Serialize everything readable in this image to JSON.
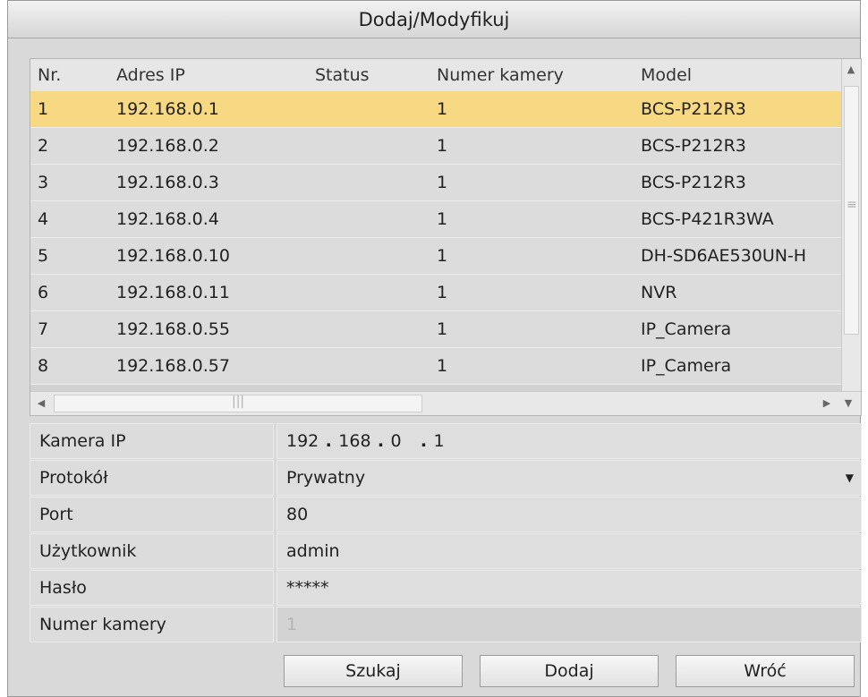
{
  "window": {
    "title": "Dodaj/Modyfikuj"
  },
  "table": {
    "columns": [
      "Nr.",
      "Adres IP",
      "Status",
      "Numer kamery",
      "Model"
    ],
    "rows": [
      [
        "1",
        "192.168.0.1",
        "",
        "1",
        "BCS-P212R3"
      ],
      [
        "2",
        "192.168.0.2",
        "",
        "1",
        "BCS-P212R3"
      ],
      [
        "3",
        "192.168.0.3",
        "",
        "1",
        "BCS-P212R3"
      ],
      [
        "4",
        "192.168.0.4",
        "",
        "1",
        "BCS-P421R3WA"
      ],
      [
        "5",
        "192.168.0.10",
        "",
        "1",
        "DH-SD6AE530UN-H"
      ],
      [
        "6",
        "192.168.0.11",
        "",
        "1",
        "NVR"
      ],
      [
        "7",
        "192.168.0.55",
        "",
        "1",
        "IP_Camera"
      ],
      [
        "8",
        "192.168.0.57",
        "",
        "1",
        "IP_Camera"
      ]
    ],
    "selected_row": 0,
    "selected_color": "#f7d883"
  },
  "form": {
    "ip_label": "Kamera IP",
    "ip_segments": [
      "192",
      "168",
      "0",
      "1"
    ],
    "protocol_label": "Protokół",
    "protocol_value": "Prywatny",
    "port_label": "Port",
    "port_value": "80",
    "user_label": "Użytkownik",
    "user_value": "admin",
    "password_label": "Hasło",
    "password_value": "*****",
    "camera_number_label": "Numer kamery",
    "camera_number_value": "1"
  },
  "buttons": {
    "search": "Szukaj",
    "add": "Dodaj",
    "back": "Wróć"
  }
}
